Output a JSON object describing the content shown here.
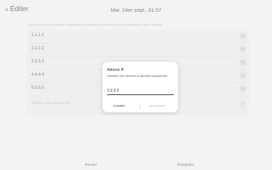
{
  "header": {
    "back_label": "Éditer",
    "title": "Mar. 24er sept., 01:57"
  },
  "description": "Vous pouvez ajouter, modifier ou supprimer les adresses IP pouvant accéder au Centralized Touch Controller",
  "ip_list": [
    {
      "label": "1.1.1.1"
    },
    {
      "label": "2.2.2.2"
    },
    {
      "label": "3.3.3.3"
    },
    {
      "label": "4.4.4.4"
    },
    {
      "label": "5.5.5.5"
    }
  ],
  "remove_icon_glyph": "−",
  "add_row": {
    "placeholder": "Ajouter une adresse IP",
    "icon_glyph": "+"
  },
  "bottom_bar": {
    "cancel_label": "Annuler",
    "save_label": "Enregistrer"
  },
  "dialog": {
    "title": "Adresse IP",
    "message": "Saisissez les nombres et périodes uniquement.",
    "input_value": "2.2.2.2",
    "cancel_label": "Annuler",
    "save_label": "Enregistrer"
  },
  "colors": {
    "background": "#f3f3f3",
    "panel": "#ececec",
    "dialog": "#ffffff",
    "disabled_text": "#bbbbbb"
  }
}
